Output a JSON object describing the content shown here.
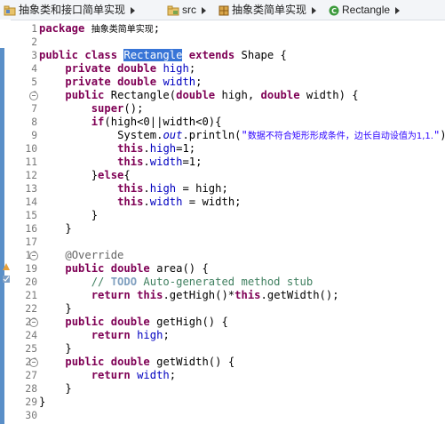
{
  "breadcrumb": {
    "project": "抽象类和接口简单实现",
    "src": "src",
    "package": "抽象类简单实现",
    "class": "Rectangle"
  },
  "editor": {
    "line_numbers": [
      "1",
      "2",
      "3",
      "4",
      "5",
      "6",
      "7",
      "8",
      "9",
      "10",
      "11",
      "12",
      "13",
      "14",
      "15",
      "16",
      "17",
      "18",
      "19",
      "20",
      "21",
      "22",
      "23",
      "24",
      "25",
      "26",
      "27",
      "28",
      "29",
      "30"
    ],
    "code": {
      "l1_kw": "package",
      "l1_pkg": "抽象类简单实现",
      "l1_semi": ";",
      "l3_kw1": "public",
      "l3_kw2": "class",
      "l3_name": "Rectangle",
      "l3_kw3": "extends",
      "l3_rest": "Shape {",
      "l4_kw1": "private",
      "l4_kw2": "double",
      "l4_field": "high",
      "l5_kw1": "private",
      "l5_kw2": "double",
      "l5_field": "width",
      "l6_kw1": "public",
      "l6_name": "Rectangle(",
      "l6_kw2": "double",
      "l6_p1": "high, ",
      "l6_kw3": "double",
      "l6_p2": "width) {",
      "l7_kw": "super",
      "l7_rest": "();",
      "l8_kw": "if",
      "l8_rest": "(high<0||width<0){",
      "l9_obj": "System.",
      "l9_out": "out",
      "l9_call": ".println(",
      "l9_str_open": "\"",
      "l9_str": "数据不符合矩形形成条件，边长自动设值为1,1.",
      "l9_str_close": "\"",
      "l9_end": ");",
      "l10_kw": "this",
      "l10_dot": ".",
      "l10_fld": "high",
      "l10_rest": "=1;",
      "l11_kw": "this",
      "l11_dot": ".",
      "l11_fld": "width",
      "l11_rest": "=1;",
      "l12_close": "}",
      "l12_kw": "else",
      "l12_open": "{",
      "l13_kw": "this",
      "l13_dot": ".",
      "l13_fld": "high",
      "l13_rest": " = high;",
      "l14_kw": "this",
      "l14_dot": ".",
      "l14_fld": "width",
      "l14_rest": " = width;",
      "l15": "}",
      "l16": "}",
      "l18_ann": "@Override",
      "l19_kw1": "public",
      "l19_kw2": "double",
      "l19_rest": "area() {",
      "l20_cmt1": "// ",
      "l20_todo": "TODO",
      "l20_cmt2": " Auto-generated method stub",
      "l21_kw1": "return",
      "l21_kw2": "this",
      "l21_mid": ".getHigh()*",
      "l21_kw3": "this",
      "l21_rest": ".getWidth();",
      "l22": "}",
      "l23_kw1": "public",
      "l23_kw2": "double",
      "l23_rest": "getHigh() {",
      "l24_kw": "return",
      "l24_fld": "high",
      "l24_semi": ";",
      "l25": "}",
      "l26_kw1": "public",
      "l26_kw2": "double",
      "l26_rest": "getWidth() {",
      "l27_kw": "return",
      "l27_fld": "width",
      "l27_semi": ";",
      "l28": "}",
      "l29": "}"
    }
  },
  "icons": {
    "project": "project-folder-icon",
    "src": "source-folder-icon",
    "package": "package-icon",
    "class": "class-icon"
  },
  "colors": {
    "keyword": "#7f0055",
    "field": "#0000c0",
    "string": "#2a00ff",
    "comment": "#3f7f5f",
    "annotation": "#646464",
    "selection": "#3875d7",
    "ruler": "#5a8fc8"
  }
}
